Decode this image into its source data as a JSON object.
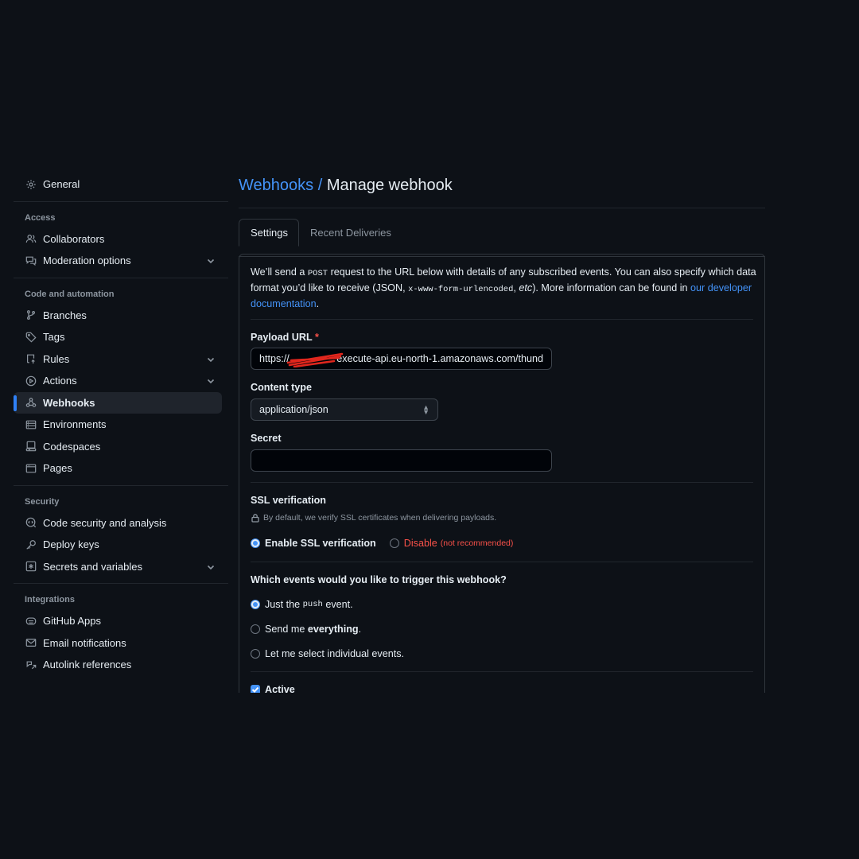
{
  "sidebar": {
    "general": "General",
    "access": {
      "heading": "Access",
      "items": [
        "Collaborators",
        "Moderation options"
      ]
    },
    "code": {
      "heading": "Code and automation",
      "items": [
        "Branches",
        "Tags",
        "Rules",
        "Actions",
        "Webhooks",
        "Environments",
        "Codespaces",
        "Pages"
      ],
      "active": "Webhooks"
    },
    "security": {
      "heading": "Security",
      "items": [
        "Code security and analysis",
        "Deploy keys",
        "Secrets and variables"
      ]
    },
    "integrations": {
      "heading": "Integrations",
      "items": [
        "GitHub Apps",
        "Email notifications",
        "Autolink references"
      ]
    }
  },
  "header": {
    "breadcrumb": "Webhooks /",
    "title": "Manage webhook"
  },
  "tabs": [
    "Settings",
    "Recent Deliveries"
  ],
  "intro": {
    "p1": "We’ll send a ",
    "post": "POST",
    "p2": " request to the URL below with details of any subscribed events. You can also specify which data format you’d like to receive (JSON, ",
    "urlencoded": "x-www-form-urlencoded",
    "p3": ", ",
    "etc": "etc",
    "p4": "). More information can be found in ",
    "link": "our developer documentation",
    "p5": "."
  },
  "form": {
    "payload_label": "Payload URL",
    "required_mark": "*",
    "payload_prefix": "https://",
    "payload_value": "execute-api.eu-north-1.amazonaws.com/thund",
    "content_type_label": "Content type",
    "content_type_value": "application/json",
    "secret_label": "Secret",
    "secret_value": "",
    "ssl_label": "SSL verification",
    "ssl_hint": "By default, we verify SSL certificates when delivering payloads.",
    "ssl_enable": "Enable SSL verification",
    "ssl_disable": "Disable",
    "ssl_disable_note": "(not recommended)",
    "events_label": "Which events would you like to trigger this webhook?",
    "event_push_a": "Just the ",
    "event_push_code": "push",
    "event_push_b": " event.",
    "event_all_a": "Send me ",
    "event_all_b": "everything",
    "event_all_c": ".",
    "event_select": "Let me select individual events.",
    "active_label": "Active"
  },
  "colors": {
    "accent": "#4493f8",
    "danger": "#f85149",
    "background": "#0d1117"
  }
}
